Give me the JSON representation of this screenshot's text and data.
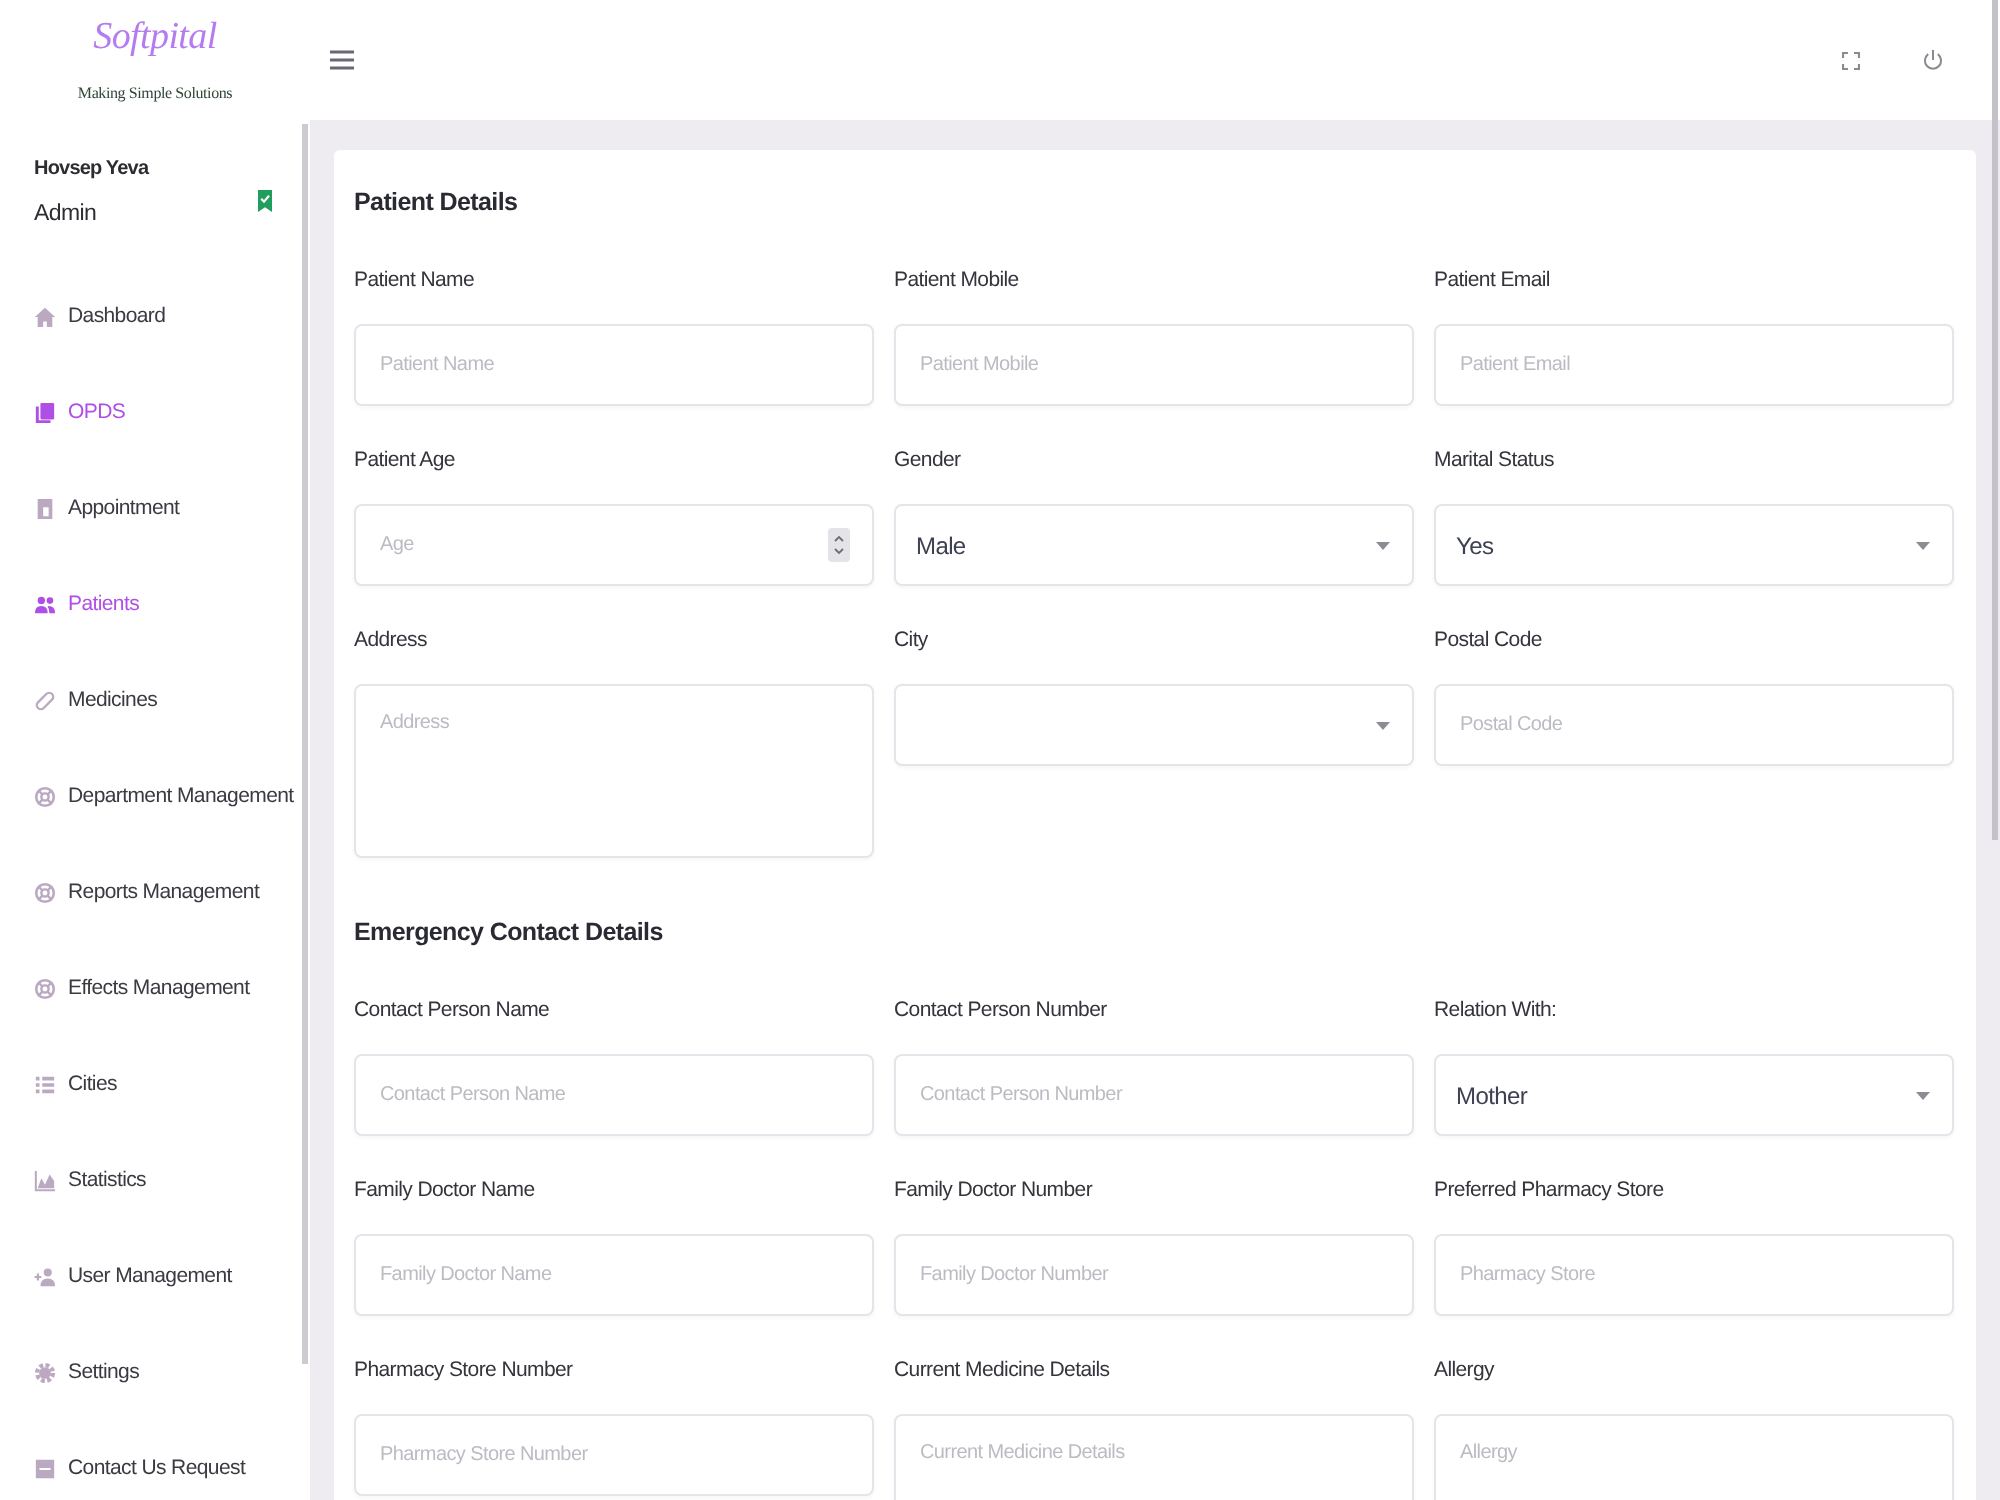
{
  "brand": {
    "name": "Softpital",
    "tagline": "Making Simple Solutions"
  },
  "user": {
    "name": "Hovsep Yeva",
    "role": "Admin"
  },
  "sidebar": {
    "items": [
      {
        "label": "Dashboard",
        "selected": false
      },
      {
        "label": "OPDS",
        "selected": true
      },
      {
        "label": "Appointment",
        "selected": false
      },
      {
        "label": "Patients",
        "selected": true
      },
      {
        "label": "Medicines",
        "selected": false
      },
      {
        "label": "Department Management",
        "selected": false
      },
      {
        "label": "Reports Management",
        "selected": false
      },
      {
        "label": "Effects Management",
        "selected": false
      },
      {
        "label": "Cities",
        "selected": false
      },
      {
        "label": "Statistics",
        "selected": false
      },
      {
        "label": "User Management",
        "selected": false
      },
      {
        "label": "Settings",
        "selected": false
      },
      {
        "label": "Contact Us Request",
        "selected": false
      }
    ]
  },
  "sections": [
    {
      "title": "Patient Details",
      "fields": [
        {
          "label": "Patient Name",
          "kind": "text",
          "placeholder": "Patient Name"
        },
        {
          "label": "Patient Mobile",
          "kind": "text",
          "placeholder": "Patient Mobile"
        },
        {
          "label": "Patient Email",
          "kind": "text",
          "placeholder": "Patient Email"
        },
        {
          "label": "Patient Age",
          "kind": "number",
          "placeholder": "Age"
        },
        {
          "label": "Gender",
          "kind": "select",
          "value": "Male"
        },
        {
          "label": "Marital Status",
          "kind": "select",
          "value": "Yes"
        },
        {
          "label": "Address",
          "kind": "textarea",
          "placeholder": "Address"
        },
        {
          "label": "City",
          "kind": "select"
        },
        {
          "label": "Postal Code",
          "kind": "text",
          "placeholder": "Postal Code"
        }
      ]
    },
    {
      "title": "Emergency Contact Details",
      "fields": [
        {
          "label": "Contact Person Name",
          "kind": "text",
          "placeholder": "Contact Person Name"
        },
        {
          "label": "Contact Person Number",
          "kind": "text",
          "placeholder": "Contact Person Number"
        },
        {
          "label": "Relation With:",
          "kind": "select",
          "value": "Mother"
        },
        {
          "label": "Family Doctor Name",
          "kind": "text",
          "placeholder": "Family Doctor Name"
        },
        {
          "label": "Family Doctor Number",
          "kind": "text",
          "placeholder": "Family Doctor Number"
        },
        {
          "label": "Preferred Pharmacy Store",
          "kind": "text",
          "placeholder": "Pharmacy Store"
        },
        {
          "label": "Pharmacy Store Number",
          "kind": "text",
          "placeholder": "Pharmacy Store Number"
        },
        {
          "label": "Current Medicine Details",
          "kind": "textarea",
          "placeholder": "Current Medicine Details"
        },
        {
          "label": "Allergy",
          "kind": "textarea",
          "placeholder": "Allergy"
        }
      ]
    }
  ]
}
